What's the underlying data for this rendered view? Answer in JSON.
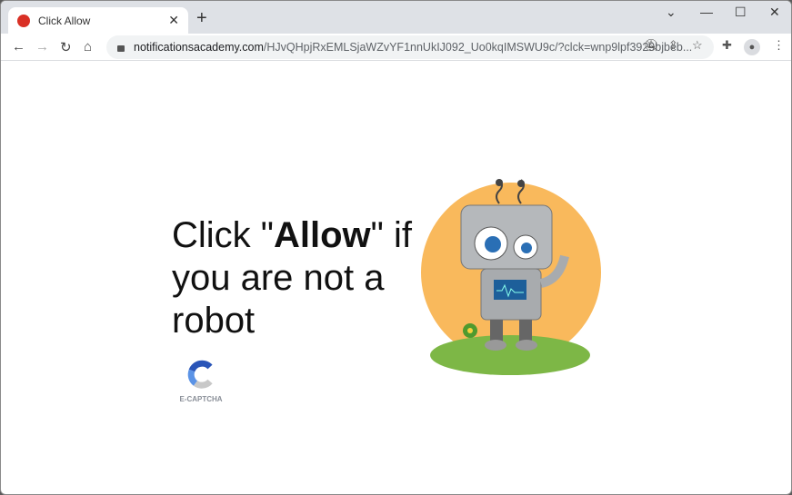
{
  "tab": {
    "title": "Click Allow",
    "favicon": "red-bird-icon"
  },
  "address": {
    "domain": "notificationsacademy.com",
    "path": "/HJvQHpjRxEMLSjaWZvYF1nnUkIJ092_Uo0kqIMSWU9c/?clck=wnp9lpf3929bjbeb..."
  },
  "page": {
    "headline_pre": "Click \"",
    "headline_bold": "Allow",
    "headline_post": "\" if you are not a robot",
    "captcha_label": "E-CAPTCHA"
  },
  "colors": {
    "accent_orange": "#f9b95c",
    "captcha_blue": "#3b78e0"
  }
}
